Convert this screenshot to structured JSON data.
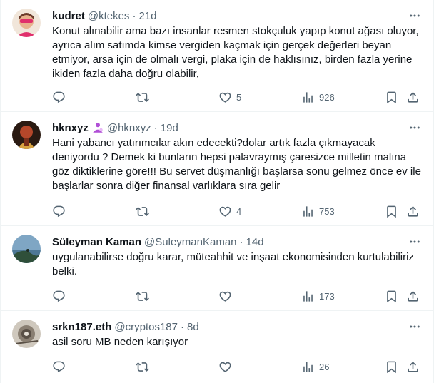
{
  "tweets": [
    {
      "display_name": "kudret",
      "handle": "@ktekes",
      "separator": "·",
      "time": "21d",
      "text": "Konut alınabilir ama bazı insanlar resmen stokçuluk yapıp konut ağası oluyor, ayrıca alım satımda kimse vergiden kaçmak için  gerçek değerleri beyan etmiyor, arsa için de olmalı vergi, plaka için de haklısınız, birden fazla yerine ikiden fazla daha doğru olabilir,",
      "replies": "",
      "retweets": "",
      "likes": "5",
      "views": "926",
      "avatar": {
        "bg": "#f1e6da",
        "accent": "#e0306c"
      }
    },
    {
      "display_name": "hknxyz",
      "handle": "@hknxyz",
      "separator": "·",
      "time": "19d",
      "badge_icon": "person-badge-icon",
      "text": "Hani yabancı yatırımcılar akın edecekti?dolar artık fazla çıkmayacak deniyordu ? Demek ki bunların hepsi palavraymış çaresizce milletin malına göz diktiklerine göre!!! Bu servet düşmanlığı başlarsa sonu gelmez önce ev ile başlarlar sonra diğer finansal varlıklara sıra gelir",
      "replies": "",
      "retweets": "",
      "likes": "4",
      "views": "753",
      "avatar": {
        "bg": "#2a1a12",
        "accent": "#d9a441"
      }
    },
    {
      "display_name": "Süleyman Kaman",
      "handle": "@SuleymanKaman",
      "separator": "·",
      "time": "14d",
      "text": "uygulanabilirse doğru karar, müteahhit ve inşaat ekonomisinden kurtulabiliriz belki.",
      "replies": "",
      "retweets": "",
      "likes": "",
      "views": "173",
      "avatar": {
        "bg": "#7fa6c4",
        "accent": "#2f4f3a"
      }
    },
    {
      "display_name": "srkn187.eth",
      "handle": "@cryptos187",
      "separator": "·",
      "time": "8d",
      "text": "asil soru MB neden karışıyor",
      "replies": "",
      "retweets": "",
      "likes": "",
      "views": "26",
      "avatar": {
        "bg": "#cfc8bd",
        "accent": "#5a5046"
      }
    }
  ]
}
